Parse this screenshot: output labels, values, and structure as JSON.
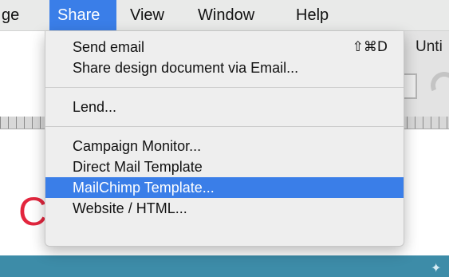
{
  "menubar": {
    "items": [
      {
        "label": "ge"
      },
      {
        "label": "Share",
        "active": true
      },
      {
        "label": "View"
      },
      {
        "label": "Window"
      },
      {
        "label": "Help"
      }
    ]
  },
  "background_window": {
    "title_fragment": "Unti"
  },
  "canvas": {
    "letter": "C"
  },
  "share_menu": {
    "send_email": {
      "label": "Send email",
      "shortcut": "⇧⌘D"
    },
    "share_design": {
      "label": "Share design document via Email..."
    },
    "lend": {
      "label": "Lend..."
    },
    "campaign_monitor": {
      "label": "Campaign Monitor..."
    },
    "direct_mail": {
      "label": "Direct Mail Template"
    },
    "mailchimp": {
      "label": "MailChimp Template...",
      "highlighted": true
    },
    "website_html": {
      "label": "Website / HTML..."
    }
  },
  "colors": {
    "highlight": "#3a7ee8",
    "menu_background": "#eeeeee",
    "menubar_background": "#e9eae9",
    "canvas_letter": "#e3263e",
    "banner": "#3d8ca8"
  }
}
